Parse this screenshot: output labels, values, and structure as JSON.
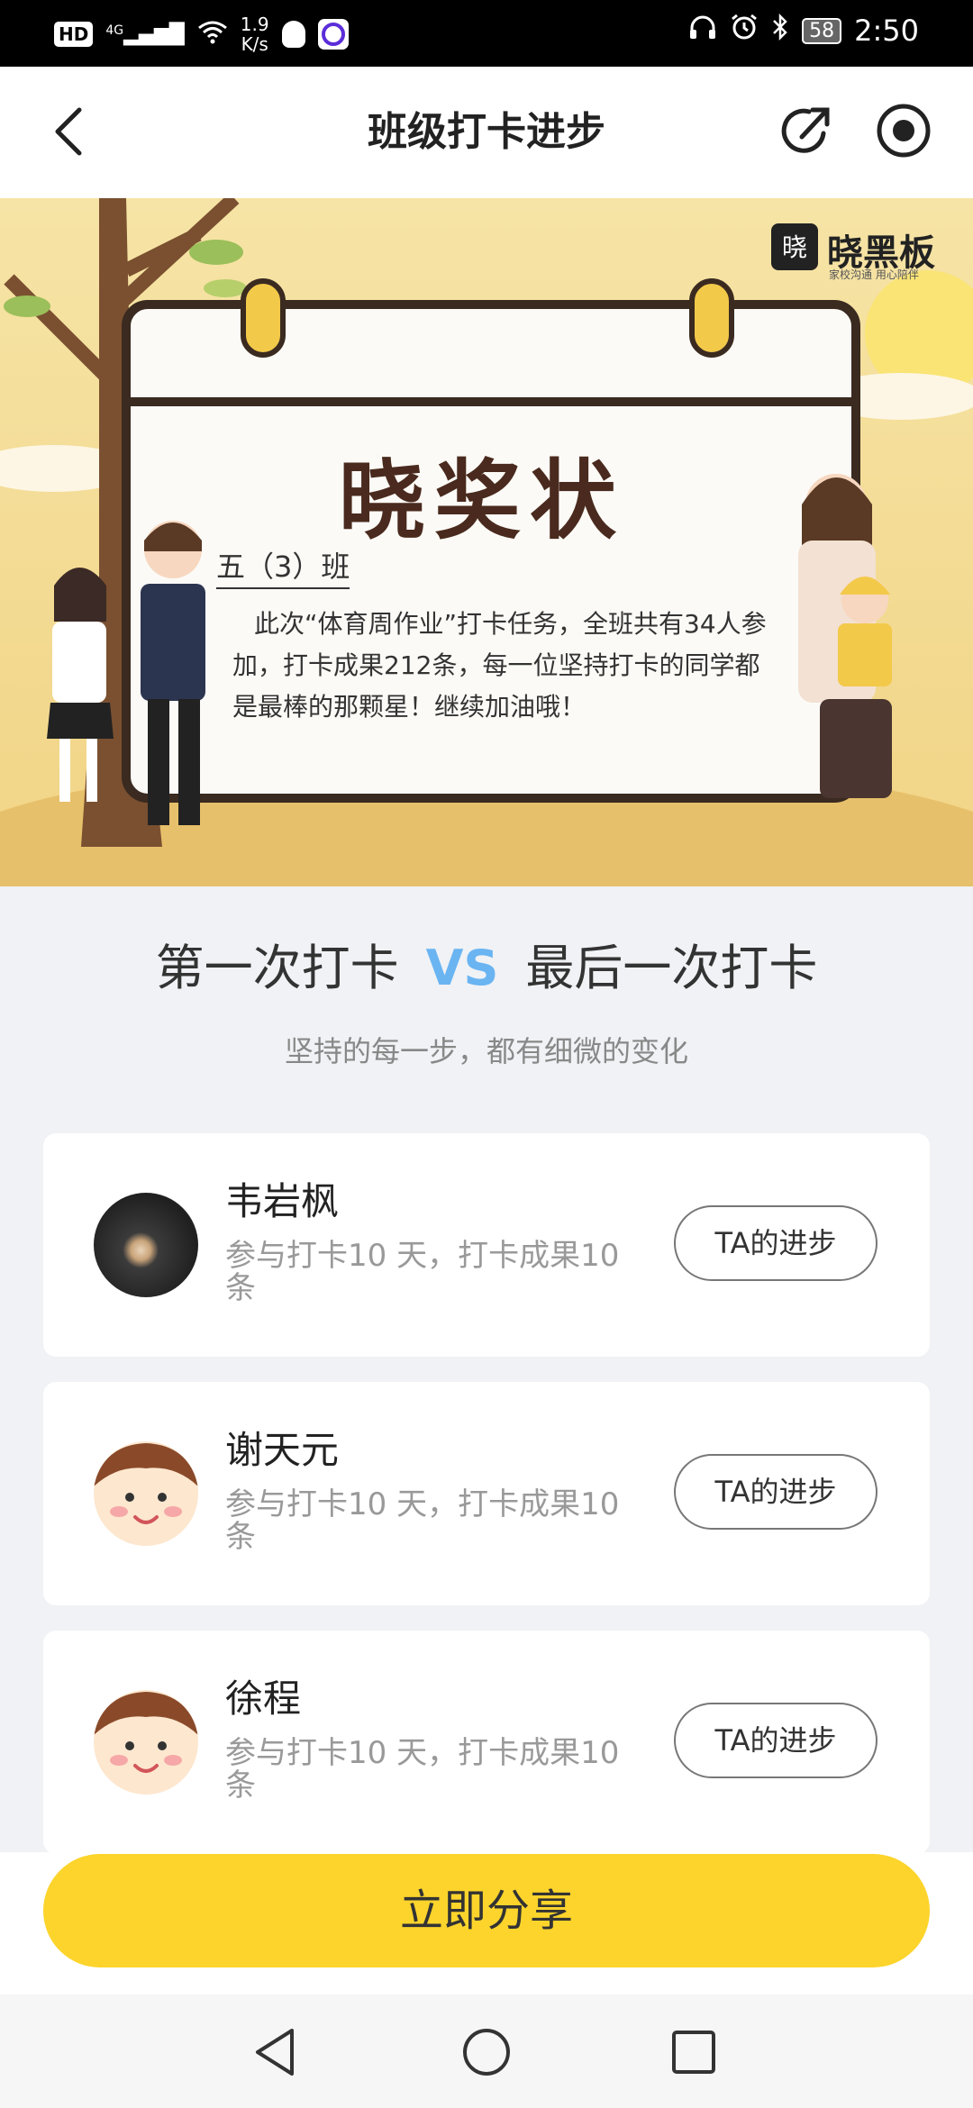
{
  "status_bar": {
    "hd": "HD",
    "network": "4G",
    "speed_value": "1.9",
    "speed_unit": "K/s",
    "battery": "58",
    "time": "2:50"
  },
  "header": {
    "title": "班级打卡进步"
  },
  "banner": {
    "brand": "晓黑板",
    "brand_tagline": "家校沟通 用心陪伴",
    "award_title": "晓奖状",
    "class_name": "五（3）班",
    "message_lines": [
      "此次“体育周作业”打卡任务，全班共有34人参",
      "加，打卡成果212条，每一位坚持打卡的同学都",
      "是最棒的那颗星！继续加油哦！"
    ]
  },
  "comparison": {
    "first": "第一次打卡",
    "vs": "VS",
    "last": "最后一次打卡",
    "subtitle": "坚持的每一步，都有细微的变化"
  },
  "students": [
    {
      "name": "韦岩枫",
      "desc": "参与打卡10 天，打卡成果10条",
      "button": "TA的进步",
      "avatar": "photo-avatar"
    },
    {
      "name": "谢天元",
      "desc": "参与打卡10 天，打卡成果10条",
      "button": "TA的进步",
      "avatar": "cartoon-face-avatar"
    },
    {
      "name": "徐程",
      "desc": "参与打卡10 天，打卡成果10条",
      "button": "TA的进步",
      "avatar": "cartoon-face-avatar"
    }
  ],
  "footer": {
    "share_button": "立即分享"
  },
  "colors": {
    "accent_yellow": "#fcd42b",
    "vs_blue": "#6ab4f2"
  }
}
